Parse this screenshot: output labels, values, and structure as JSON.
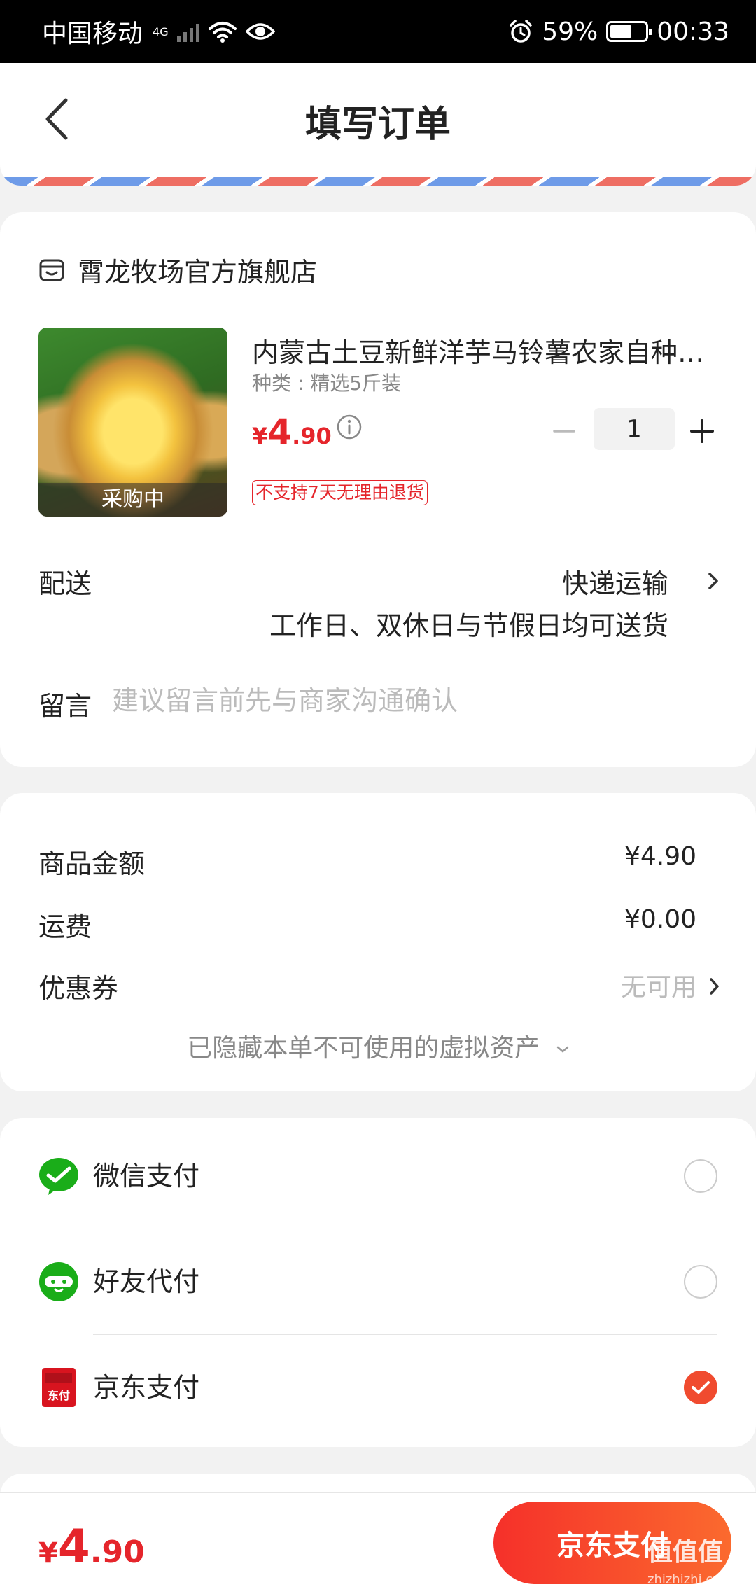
{
  "status_bar": {
    "carrier": "中国移动",
    "network": "4G",
    "battery": "59%",
    "time": "00:33"
  },
  "header": {
    "title": "填写订单"
  },
  "shop": {
    "name": "霄龙牧场官方旗舰店"
  },
  "product": {
    "name": "内蒙古土豆新鲜洋芋马铃薯农家自种土豆",
    "variant": "种类 : 精选5斤装",
    "price_currency": "¥",
    "price_int": "4",
    "price_dec": ".90",
    "quantity": "1",
    "image_badge": "采购中",
    "return_policy": "不支持7天无理由退货"
  },
  "delivery": {
    "label": "配送",
    "method": "快递运输",
    "note": "工作日、双休日与节假日均可送货"
  },
  "message": {
    "label": "留言",
    "placeholder": "建议留言前先与商家沟通确认"
  },
  "summary": {
    "goods_label": "商品金额",
    "goods_value": "¥4.90",
    "shipping_label": "运费",
    "shipping_value": "¥0.00",
    "coupon_label": "优惠券",
    "coupon_value": "无可用",
    "hidden_assets": "已隐藏本单不可使用的虚拟资产"
  },
  "payment": {
    "options": [
      {
        "label": "微信支付",
        "selected": false
      },
      {
        "label": "好友代付",
        "selected": false
      },
      {
        "label": "京东支付",
        "selected": true
      }
    ],
    "jd_icon_text": "东付"
  },
  "footer": {
    "total_currency": "¥",
    "total_int": "4",
    "total_dec": ".90",
    "button_label": "京东支付",
    "watermark": "值值值",
    "watermark_sub": "zhizhizhi.com"
  },
  "colors": {
    "accent_red": "#e5252b",
    "button_gradient_start": "#f5302a",
    "button_gradient_end": "#fb6a2e",
    "radio_checked": "#f04b2f",
    "wechat_green": "#1aad19"
  }
}
